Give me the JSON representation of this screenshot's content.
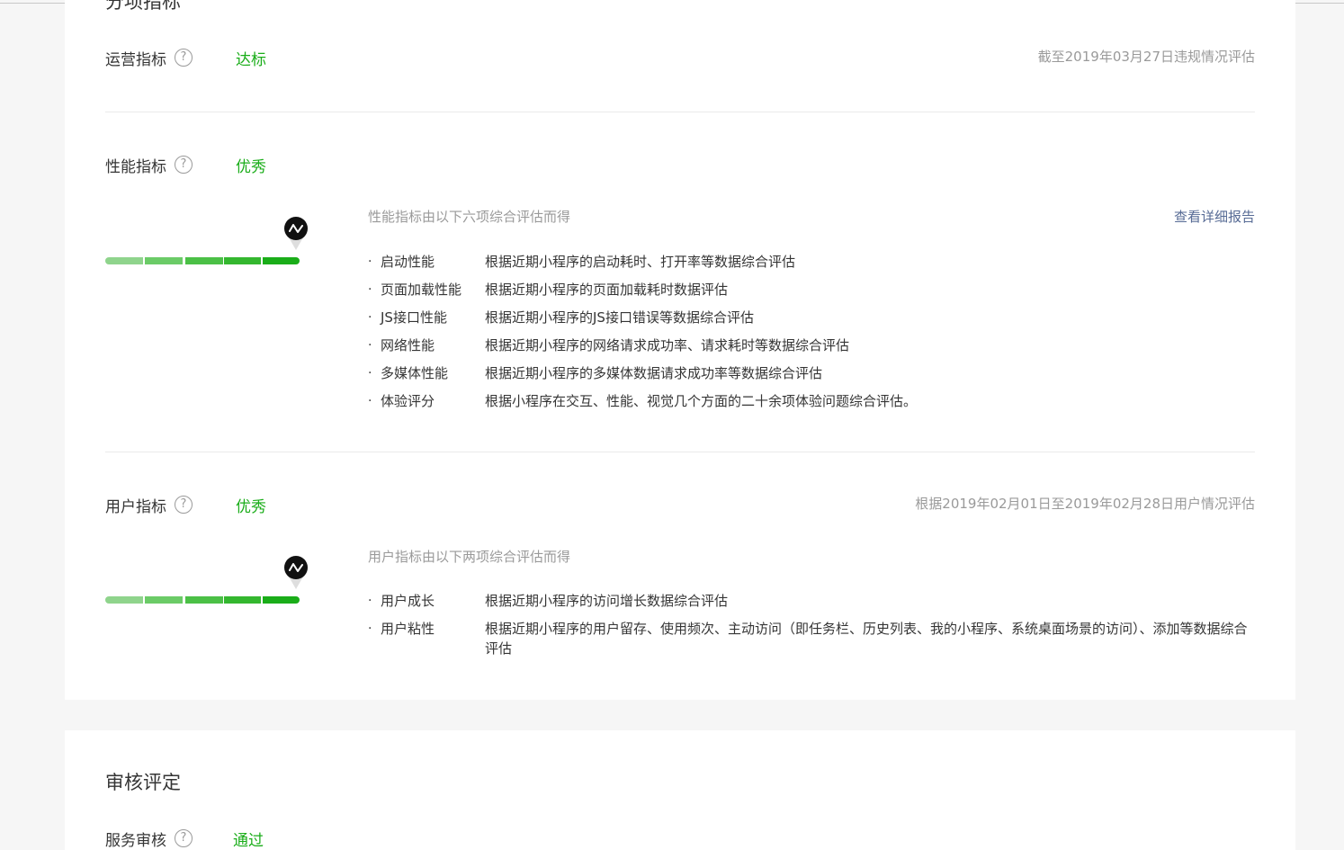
{
  "section_title": "分项指标",
  "operation": {
    "label": "运营指标",
    "help": "?",
    "status": "达标",
    "note": "截至2019年03月27日违规情况评估"
  },
  "performance": {
    "label": "性能指标",
    "help": "?",
    "status": "优秀",
    "level": 5,
    "level_max": 5,
    "desc": "性能指标由以下六项综合评估而得",
    "link": "查看详细报告",
    "items": [
      {
        "name": "启动性能",
        "text": "根据近期小程序的启动耗时、打开率等数据综合评估"
      },
      {
        "name": "页面加载性能",
        "text": "根据近期小程序的页面加载耗时数据评估"
      },
      {
        "name": "JS接口性能",
        "text": "根据近期小程序的JS接口错误等数据综合评估"
      },
      {
        "name": "网络性能",
        "text": "根据近期小程序的网络请求成功率、请求耗时等数据综合评估"
      },
      {
        "name": "多媒体性能",
        "text": "根据近期小程序的多媒体数据请求成功率等数据综合评估"
      },
      {
        "name": "体验评分",
        "text": "根据小程序在交互、性能、视觉几个方面的二十余项体验问题综合评估。"
      }
    ]
  },
  "user": {
    "label": "用户指标",
    "help": "?",
    "status": "优秀",
    "level": 5,
    "level_max": 5,
    "note": "根据2019年02月01日至2019年02月28日用户情况评估",
    "desc": "用户指标由以下两项综合评估而得",
    "items": [
      {
        "name": "用户成长",
        "text": "根据近期小程序的访问增长数据综合评估"
      },
      {
        "name": "用户粘性",
        "text": "根据近期小程序的用户留存、使用频次、主动访问（即任务栏、历史列表、我的小程序、系统桌面场景的访问）、添加等数据综合评估"
      }
    ]
  },
  "review": {
    "title": "审核评定",
    "service": {
      "label": "服务审核",
      "help": "?",
      "status": "通过"
    }
  },
  "colors": {
    "success": "#1aad19",
    "link": "#576b95",
    "muted": "#9a9a9a",
    "text": "#353535"
  },
  "icons": {
    "help": "question-circle-icon",
    "gauge_pin": "trend-line-icon"
  }
}
